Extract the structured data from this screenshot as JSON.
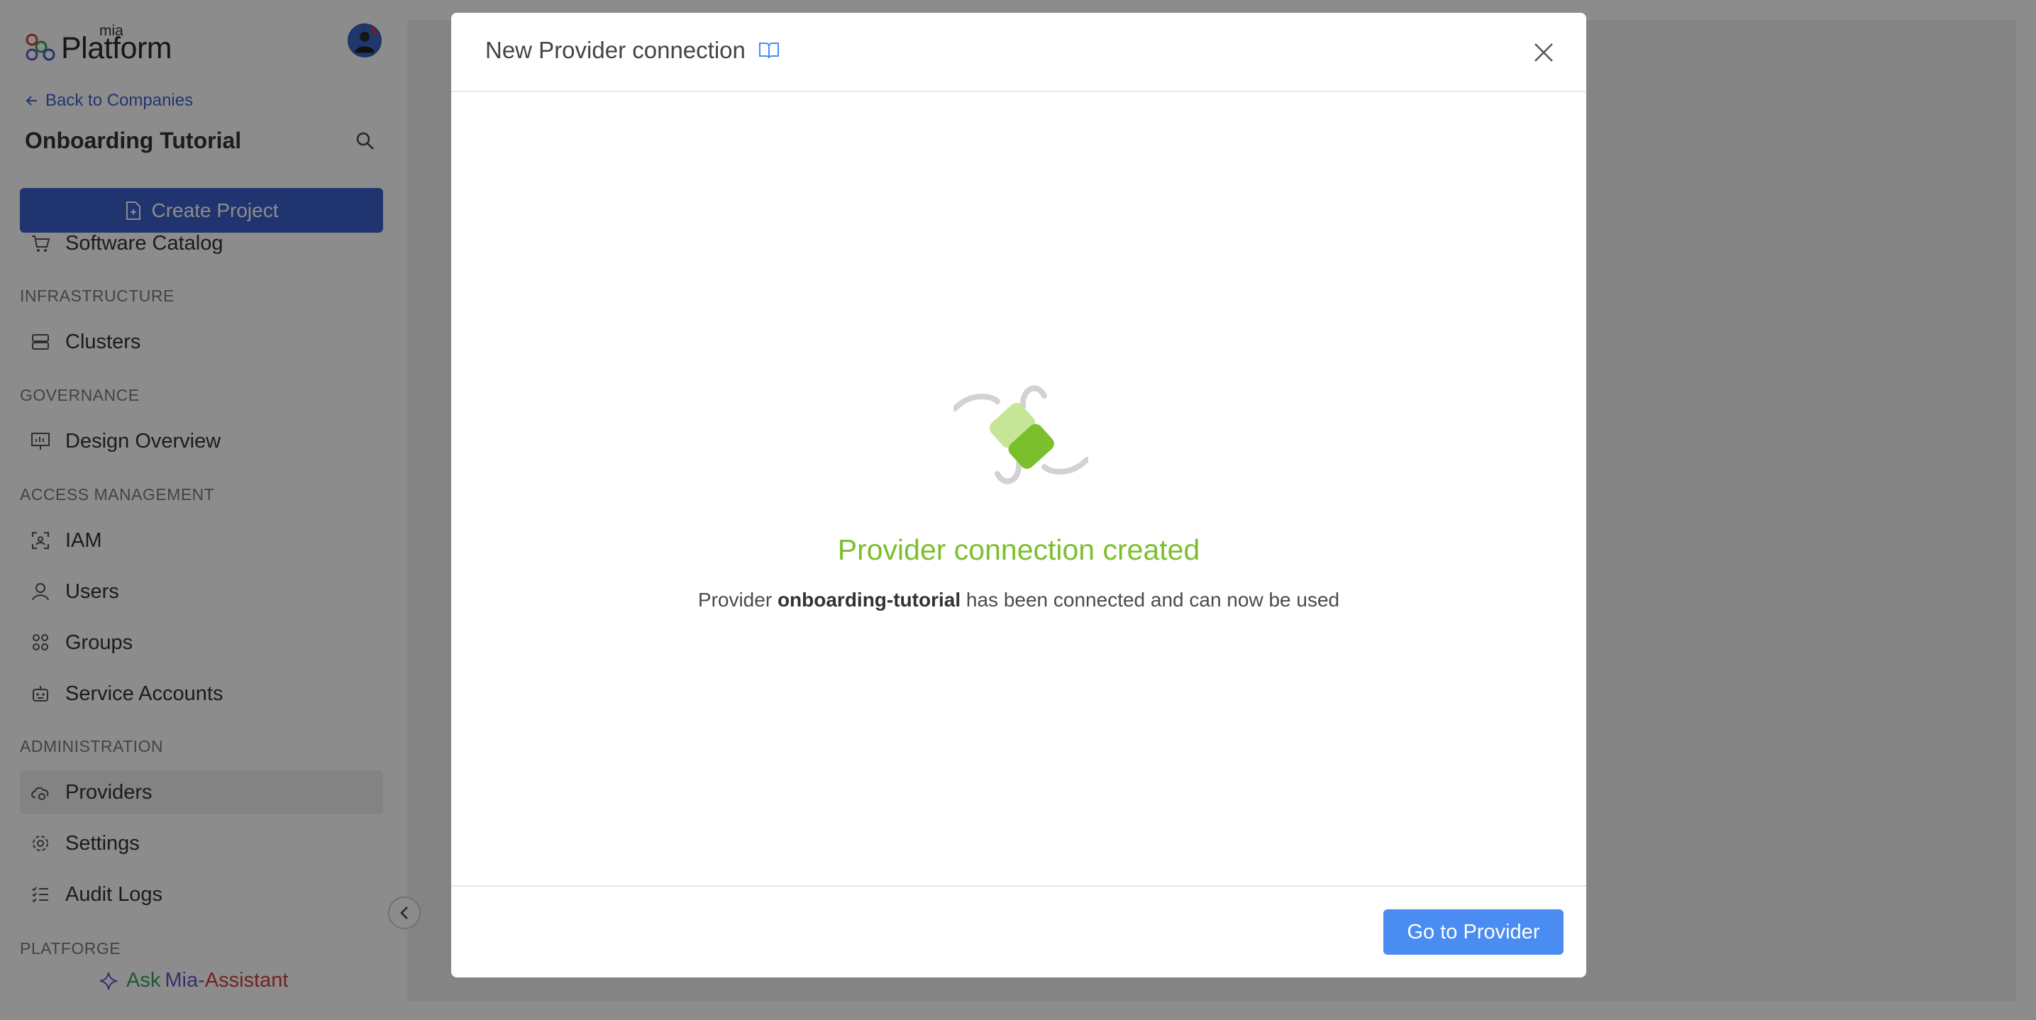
{
  "sidebar": {
    "logo": {
      "small": "mia",
      "main": "Platform"
    },
    "back_link": "Back to Companies",
    "company_name": "Onboarding Tutorial",
    "create_project": "Create Project",
    "software_catalog": "Software Catalog",
    "sections": {
      "infrastructure": "INFRASTRUCTURE",
      "governance": "GOVERNANCE",
      "access_management": "ACCESS MANAGEMENT",
      "administration": "ADMINISTRATION",
      "platforge": "PLATFORGE"
    },
    "items": {
      "clusters": "Clusters",
      "design_overview": "Design Overview",
      "iam": "IAM",
      "users": "Users",
      "groups": "Groups",
      "service_accounts": "Service Accounts",
      "providers": "Providers",
      "settings": "Settings",
      "audit_logs": "Audit Logs"
    },
    "ask": {
      "prefix": "Ask",
      "mia": "Mia-",
      "assistant": "Assistant"
    }
  },
  "modal": {
    "title": "New Provider connection",
    "success_title": "Provider connection created",
    "message_prefix": "Provider",
    "provider_name": "onboarding-tutorial",
    "message_suffix": "has been connected and can now be used",
    "go_button": "Go to Provider"
  },
  "colors": {
    "primary": "#3b5fcb",
    "success": "#7cbf2d",
    "button": "#4a8cf2"
  }
}
